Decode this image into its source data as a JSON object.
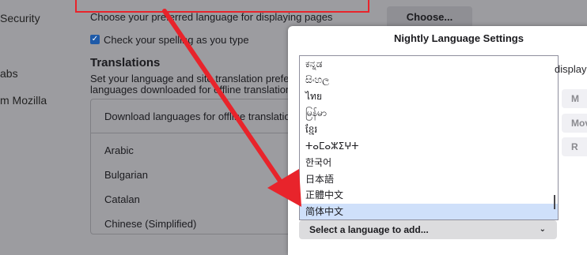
{
  "sidebar": {
    "items": [
      {
        "label": "Security"
      },
      {
        "label": "abs"
      },
      {
        "label": "m Mozilla"
      }
    ]
  },
  "language": {
    "description": "Choose your preferred language for displaying pages",
    "choose_button": "Choose...",
    "spellcheck_label": "Check your spelling as you type",
    "spellcheck_checked": true
  },
  "translations": {
    "title": "Translations",
    "description_line1": "Set your language and site translation preferenc",
    "description_line2": "languages downloaded for offline translation.",
    "panel_header": "Download languages for offline translation",
    "languages": [
      "Arabic",
      "Bulgarian",
      "Catalan",
      "Chinese (Simplified)"
    ]
  },
  "dialog": {
    "title": "Nightly Language Settings",
    "list_items": [
      "ಕನ್ನಡ",
      "සිංහල",
      "ไทย",
      "မြန်မာ",
      "ខ្មែរ",
      "ⵜⴰⵎⴰⵣⵉⵖⵜ",
      "한국어",
      "日本語",
      "正體中文",
      "简体中文"
    ],
    "selected_item": "简体中文",
    "select_placeholder": "Select a language to add...",
    "right_text": "display a",
    "buttons": [
      "M",
      "Mov",
      "R"
    ]
  },
  "colors": {
    "highlight": "#e8242b",
    "selected_row": "#cfe0fa",
    "checkbox": "#1e5aa8"
  }
}
